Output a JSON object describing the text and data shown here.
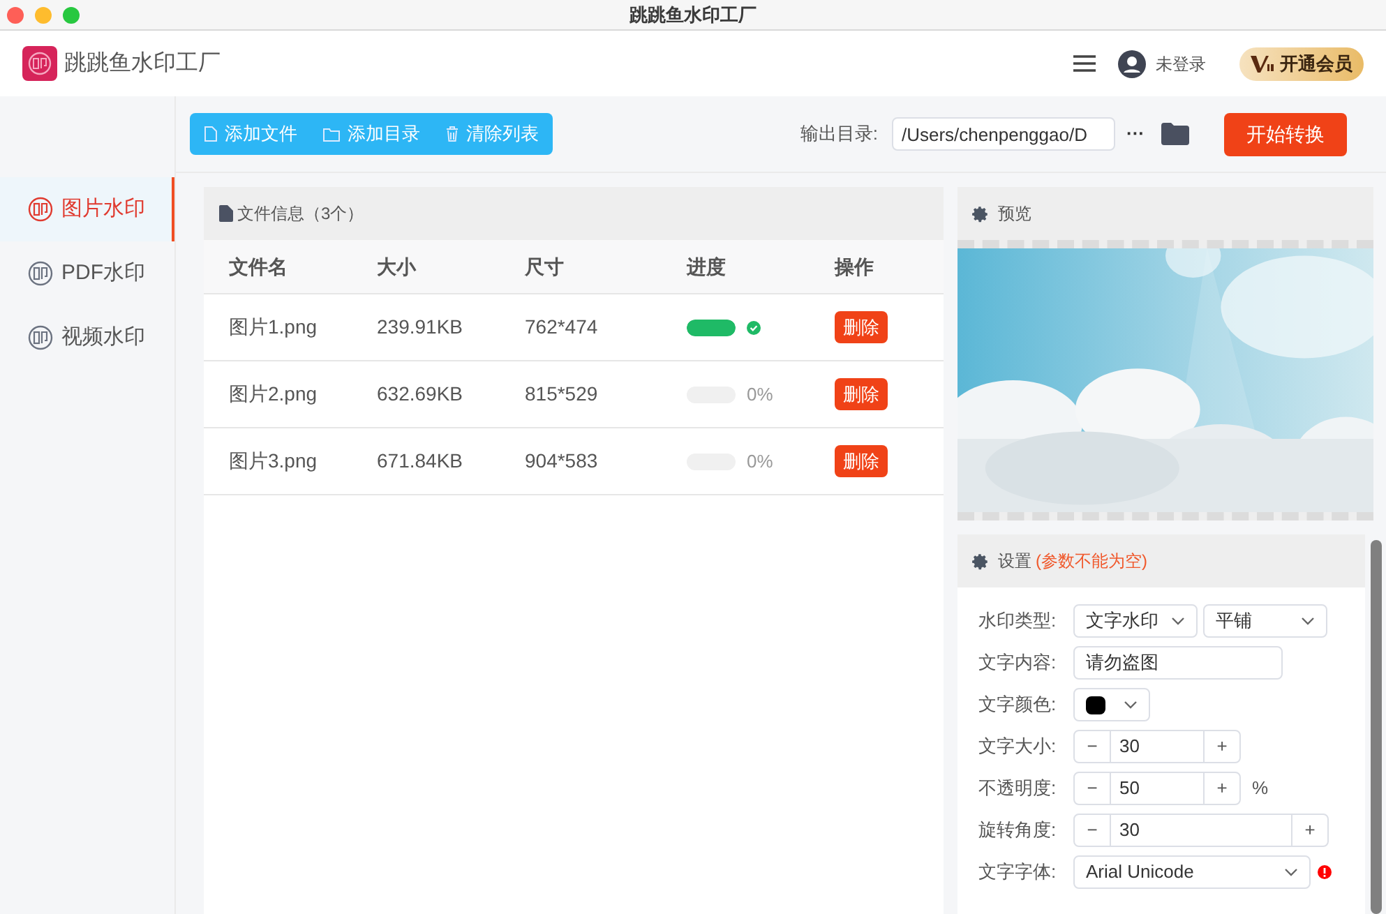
{
  "window": {
    "title": "跳跳鱼水印工厂"
  },
  "header": {
    "app_name": "跳跳鱼水印工厂",
    "user": "未登录",
    "vip_button": "开通会员"
  },
  "sidebar": {
    "items": [
      {
        "label": "图片水印",
        "selected": true
      },
      {
        "label": "PDF水印",
        "selected": false
      },
      {
        "label": "视频水印",
        "selected": false
      }
    ]
  },
  "toolbar": {
    "buttons": [
      {
        "label": "添加文件",
        "kind": "file"
      },
      {
        "label": "添加目录",
        "kind": "folder"
      },
      {
        "label": "清除列表",
        "kind": "trash"
      }
    ],
    "output_label": "输出目录:",
    "output_path": "/Users/chenpenggao/D",
    "more": "···",
    "start_button": "开始转换"
  },
  "files": {
    "title": "文件信息（3个）",
    "columns": [
      "文件名",
      "大小",
      "尺寸",
      "进度",
      "操作"
    ],
    "rows": [
      {
        "name": "图片1.png",
        "size": "239.91KB",
        "dims": "762*474",
        "level": 1,
        "action": "删除"
      },
      {
        "name": "图片2.png",
        "size": "632.69KB",
        "dims": "815*529",
        "level": 0,
        "reading": "0%",
        "action": "删除"
      },
      {
        "name": "图片3.png",
        "size": "671.84KB",
        "dims": "904*583",
        "level": 0,
        "reading": "0%",
        "action": "删除"
      }
    ]
  },
  "preview": {
    "title": "预览"
  },
  "settings": {
    "title": "设置",
    "note": "(参数不能为空)",
    "rows": [
      {
        "kind": "select2",
        "label": "水印类型:",
        "value": "文字水印",
        "value2": "平铺"
      },
      {
        "kind": "text",
        "label": "文字内容:",
        "value": "请勿盗图"
      },
      {
        "kind": "color",
        "label": "文字颜色:",
        "color": "#000000"
      },
      {
        "kind": "stepper",
        "label": "文字大小:",
        "value": "30",
        "minus": "−",
        "plus": "+",
        "wide": false
      },
      {
        "kind": "stepper",
        "label": "不透明度:",
        "value": "50",
        "minus": "−",
        "plus": "+",
        "unit": "%",
        "wide": false
      },
      {
        "kind": "stepper",
        "label": "旋转角度:",
        "value": "30",
        "minus": "−",
        "plus": "+",
        "wide": true
      },
      {
        "kind": "select",
        "label": "文字字体:",
        "value": "Arial Unicode",
        "error": true
      }
    ]
  }
}
